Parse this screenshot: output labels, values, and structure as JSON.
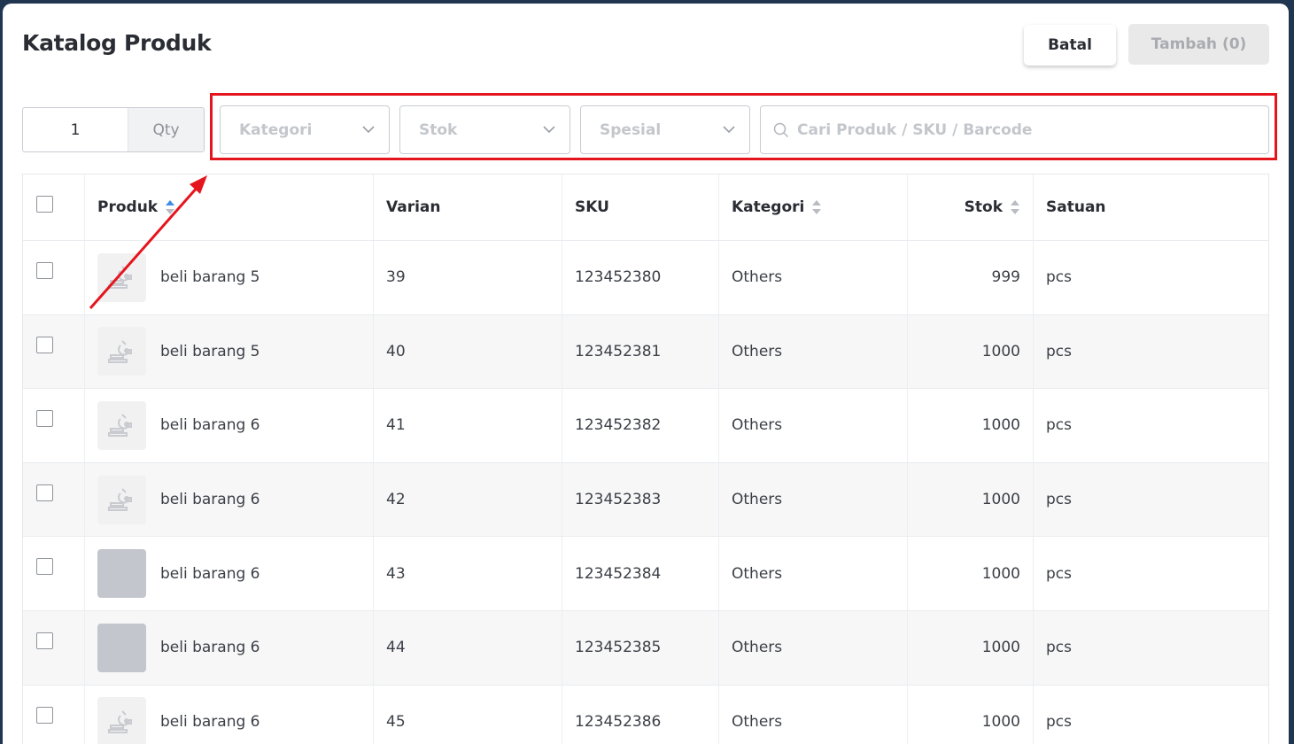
{
  "modal": {
    "title": "Katalog Produk",
    "cancel_label": "Batal",
    "add_label": "Tambah (0)"
  },
  "qty": {
    "value": "1",
    "label": "Qty"
  },
  "filters": {
    "kategori_placeholder": "Kategori",
    "stok_placeholder": "Stok",
    "spesial_placeholder": "Spesial",
    "search_placeholder": "Cari Produk / SKU / Barcode"
  },
  "table": {
    "headers": {
      "produk": "Produk",
      "varian": "Varian",
      "sku": "SKU",
      "kategori": "Kategori",
      "stok": "Stok",
      "satuan": "Satuan"
    },
    "rows": [
      {
        "produk": "beli barang 5",
        "varian": "39",
        "sku": "123452380",
        "kategori": "Others",
        "stok": "999",
        "satuan": "pcs"
      },
      {
        "produk": "beli barang 5",
        "varian": "40",
        "sku": "123452381",
        "kategori": "Others",
        "stok": "1000",
        "satuan": "pcs"
      },
      {
        "produk": "beli barang 6",
        "varian": "41",
        "sku": "123452382",
        "kategori": "Others",
        "stok": "1000",
        "satuan": "pcs"
      },
      {
        "produk": "beli barang 6",
        "varian": "42",
        "sku": "123452383",
        "kategori": "Others",
        "stok": "1000",
        "satuan": "pcs"
      },
      {
        "produk": "beli barang 6",
        "varian": "43",
        "sku": "123452384",
        "kategori": "Others",
        "stok": "1000",
        "satuan": "pcs"
      },
      {
        "produk": "beli barang 6",
        "varian": "44",
        "sku": "123452385",
        "kategori": "Others",
        "stok": "1000",
        "satuan": "pcs"
      },
      {
        "produk": "beli barang 6",
        "varian": "45",
        "sku": "123452386",
        "kategori": "Others",
        "stok": "1000",
        "satuan": "pcs"
      }
    ]
  },
  "colors": {
    "highlight": "#e5151e",
    "sort_active": "#3d8fe6",
    "sort_inactive": "#b9bcc2"
  },
  "icons": {
    "thumbnail_placeholder": "scale-image-icon",
    "search": "search-icon",
    "dropdown": "chevron-down-icon"
  }
}
